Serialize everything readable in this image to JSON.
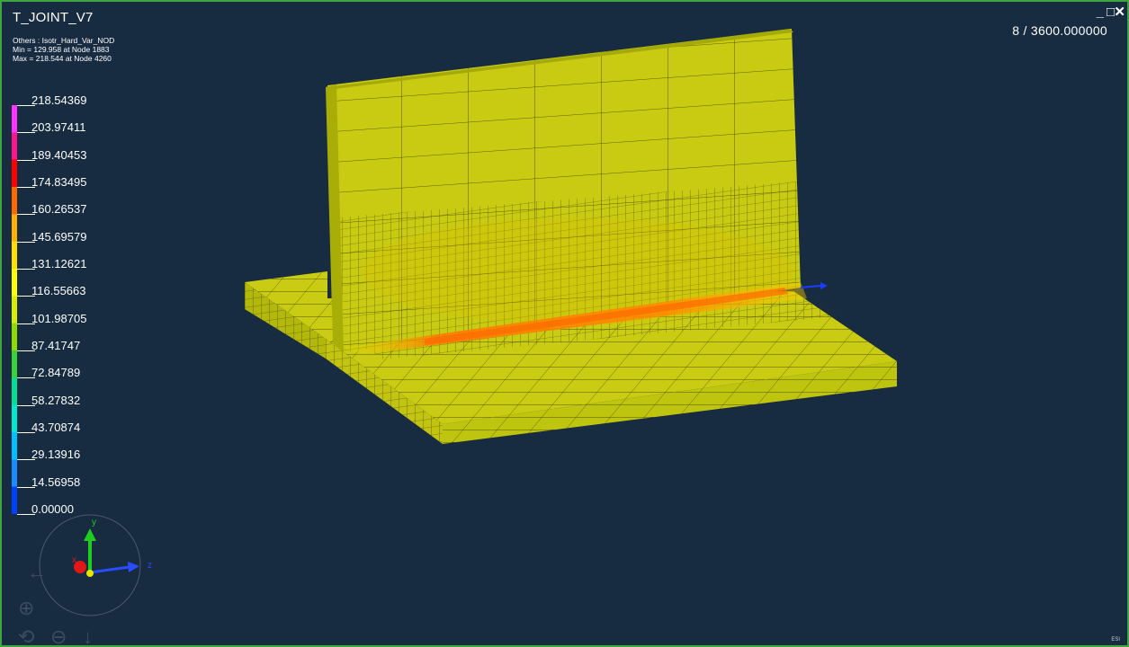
{
  "title": "T_JOINT_V7",
  "info": {
    "result": "Others : Isotr_Hard_Var_NOD",
    "min": "Min = 129.958 at Node 1883",
    "max": "Max = 218.544 at Node 4260"
  },
  "frame": "8 / 3600.000000",
  "window_controls": {
    "minimize": "_",
    "restore": "□",
    "close": "✕"
  },
  "legend": {
    "labels": [
      "218.54369",
      "203.97411",
      "189.40453",
      "174.83495",
      "160.26537",
      "145.69579",
      "131.12621",
      "116.55663",
      "101.98705",
      "87.41747",
      "72.84789",
      "58.27832",
      "43.70874",
      "29.13916",
      "14.56958",
      "0.00000"
    ],
    "colors": [
      "#ff33ff",
      "#ff1490",
      "#ff0000",
      "#ff6a00",
      "#ffb000",
      "#ffe000",
      "#ffff00",
      "#d8ef00",
      "#8edc00",
      "#3ad23a",
      "#00e095",
      "#00e8d0",
      "#00bfff",
      "#1a8cff",
      "#0040ff"
    ]
  },
  "triad": {
    "y_label": "y",
    "x_label": "x",
    "z_label": "z"
  },
  "nav": {
    "left": "←",
    "zoom_in": "⊕",
    "zoom_out": "⊖",
    "rotate": "⟲",
    "down": "↓"
  },
  "corner_mark": "ESI"
}
